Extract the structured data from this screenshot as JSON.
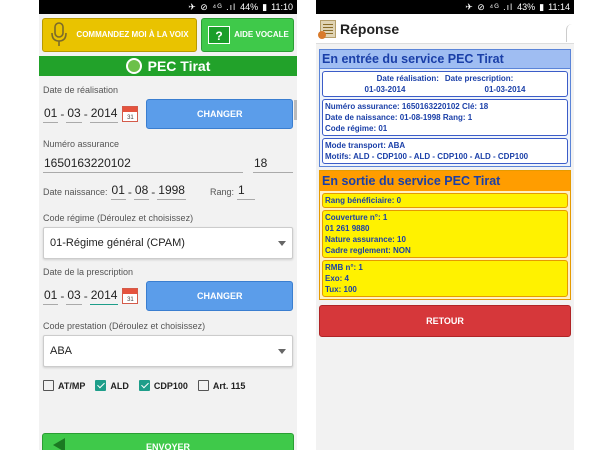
{
  "left": {
    "status": {
      "icons": "✈ ⊘ ⁴ᴳ .ıl",
      "battery": "44%",
      "time": "11:10"
    },
    "voice_button": "COMMANDEZ MOI À LA VOIX",
    "help_button": {
      "icon": "?",
      "label": "AIDE VOCALE"
    },
    "banner": "PEC Tirat",
    "date_realisation": {
      "label": "Date de réalisation",
      "day": "01",
      "month": "03",
      "year": "2014",
      "cal_day": "31",
      "button": "CHANGER"
    },
    "numero_assurance": {
      "label": "Numéro assurance",
      "value": "1650163220102",
      "key": "18"
    },
    "date_naissance": {
      "label": "Date naissance:",
      "day": "01",
      "month": "08",
      "year": "1998",
      "rang_label": "Rang:",
      "rang": "1"
    },
    "code_regime": {
      "label": "Code régime (Déroulez et choisissez)",
      "selected": "01-Régime général (CPAM)"
    },
    "date_prescription": {
      "label": "Date de la prescription",
      "day": "01",
      "month": "03",
      "year": "2014",
      "cal_day": "31",
      "button": "CHANGER"
    },
    "code_prestation": {
      "label": "Code prestation  (Déroulez et choisissez)",
      "selected": "ABA"
    },
    "checks": [
      {
        "label": "AT/MP",
        "checked": false
      },
      {
        "label": "ALD",
        "checked": true
      },
      {
        "label": "CDP100",
        "checked": true
      },
      {
        "label": "Art. 115",
        "checked": false
      }
    ],
    "send_button": "ENVOYER"
  },
  "right": {
    "status": {
      "icons": "✈ ⊘ ⁴ᴳ .ıl",
      "battery": "43%",
      "time": "11:14"
    },
    "title": "Réponse",
    "entree": {
      "header": "En entrée du service PEC Tirat",
      "dates_head_1": "Date réalisation:",
      "dates_head_2": "Date prescription:",
      "date_real": "01-03-2014",
      "date_presc": "01-03-2014",
      "line_assurance": "Numéro assurance: 1650163220102 Clé: 18",
      "line_naissance": "Date de naissance: 01-08-1998 Rang: 1",
      "line_regime": "Code régime: 01",
      "line_transport": "Mode transport: ABA",
      "line_motifs": "Motifs: ALD - CDP100 - ALD - CDP100 - ALD - CDP100"
    },
    "sortie": {
      "header": "En sortie du service PEC Tirat",
      "rang": "Rang bénéficiaire: 0",
      "couverture": "Couverture n°: 1",
      "numero": "01 261 9880",
      "nature": "Nature assurance: 10",
      "cadre": "Cadre reglement: NON",
      "rmb": "RMB n°: 1",
      "exo": "Exo: 4",
      "tux": "Tux: 100"
    },
    "return_button": "RETOUR"
  }
}
